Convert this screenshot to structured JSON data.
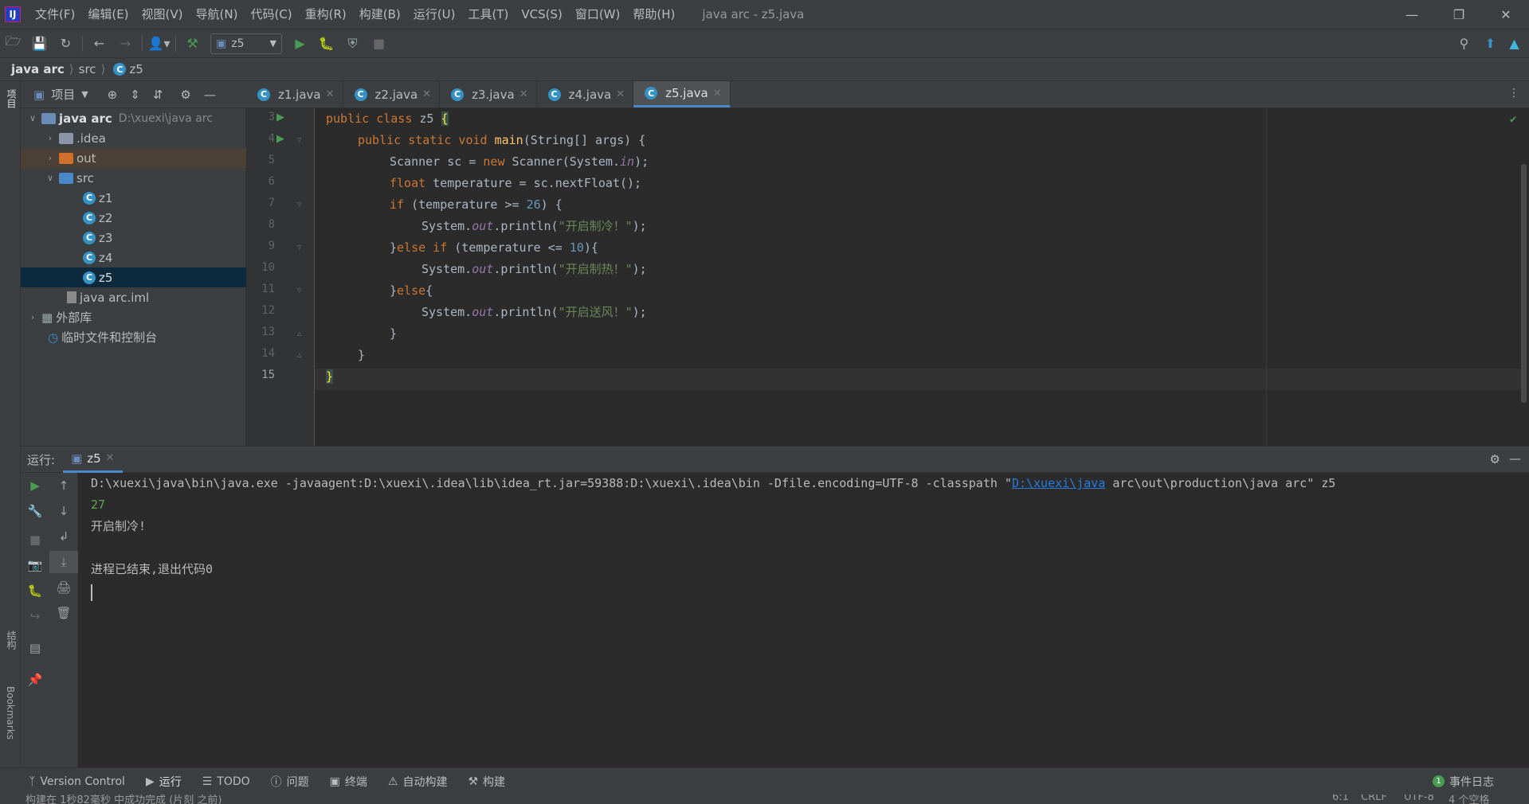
{
  "window": {
    "title": "java arc - z5.java"
  },
  "menu": [
    "文件(F)",
    "编辑(E)",
    "视图(V)",
    "导航(N)",
    "代码(C)",
    "重构(R)",
    "构建(B)",
    "运行(U)",
    "工具(T)",
    "VCS(S)",
    "窗口(W)",
    "帮助(H)"
  ],
  "toolbar": {
    "run_config": "z5"
  },
  "breadcrumb": [
    "java arc",
    "src",
    "z5"
  ],
  "project_panel": {
    "title": "项目",
    "tree": {
      "root": {
        "label": "java arc",
        "path": "D:\\xuexi\\java arc"
      },
      "idea": ".idea",
      "out": "out",
      "src": "src",
      "z1": "z1",
      "z2": "z2",
      "z3": "z3",
      "z4": "z4",
      "z5": "z5",
      "iml": "java arc.iml",
      "external": "外部库",
      "scratches": "临时文件和控制台"
    }
  },
  "tabs": [
    "z1.java",
    "z2.java",
    "z3.java",
    "z4.java",
    "z5.java"
  ],
  "active_tab": "z5.java",
  "code": {
    "line_numbers": [
      "3",
      "4",
      "5",
      "6",
      "7",
      "8",
      "9",
      "10",
      "11",
      "12",
      "13",
      "14",
      "15"
    ],
    "l3": {
      "kw": "public class",
      "name": "z5",
      "brace": "{"
    },
    "l4": {
      "kw": "public static void",
      "fn": "main",
      "rest": "(String[] args) {"
    },
    "l5": {
      "a": "Scanner sc = ",
      "kw": "new",
      "b": " Scanner(System.",
      "fld": "in",
      "c": ");"
    },
    "l6": {
      "kw": "float",
      "rest": " temperature = sc.nextFloat();"
    },
    "l7": {
      "kw": "if",
      "a": " (temperature >= ",
      "num": "26",
      "b": ") {"
    },
    "l8": {
      "a": "System.",
      "fld": "out",
      "b": ".println(",
      "str": "\"开启制冷！\"",
      "c": ");"
    },
    "l9": {
      "a": "}",
      "kw": "else if",
      "b": " (temperature <= ",
      "num": "10",
      "c": "){"
    },
    "l10": {
      "a": "System.",
      "fld": "out",
      "b": ".println(",
      "str": "\"开启制热！\"",
      "c": ");"
    },
    "l11": {
      "a": "}",
      "kw": "else",
      "b": "{"
    },
    "l12": {
      "a": "System.",
      "fld": "out",
      "b": ".println(",
      "str": "\"开启送风！\"",
      "c": ");"
    },
    "l13": "}",
    "l14": "}",
    "l15": "}"
  },
  "run_panel": {
    "label": "运行:",
    "tab": "z5",
    "output": {
      "cmd_before": "D:\\xuexi\\java\\bin\\java.exe -javaagent:D:\\xuexi\\.idea\\lib\\idea_rt.jar=59388:D:\\xuexi\\.idea\\bin -Dfile.encoding=UTF-8 -classpath \"",
      "cmd_link": "D:\\xuexi\\java",
      "cmd_after": " arc\\out\\production\\java arc\" z5",
      "input": "27",
      "result": "开启制冷!",
      "exit": "进程已结束,退出代码0"
    }
  },
  "bottom_tabs": [
    "Version Control",
    "运行",
    "TODO",
    "问题",
    "终端",
    "自动构建",
    "构建"
  ],
  "event_log": "事件日志",
  "side_labels": {
    "project": "项目",
    "structure": "结构",
    "bookmarks": "Bookmarks"
  },
  "status": {
    "message": "构建在 1秒82毫秒 中成功完成 (片刻 之前)",
    "position": "6:1",
    "line_sep": "CRLF",
    "encoding": "UTF-8",
    "indent": "4 个空格"
  },
  "colors": {
    "accent": "#4a88c7",
    "keyword": "#cc7832",
    "function": "#ffc66d",
    "string": "#6a8759",
    "number": "#6897bb",
    "field": "#9876aa",
    "run_green": "#499c54",
    "input_green": "#62a553"
  }
}
